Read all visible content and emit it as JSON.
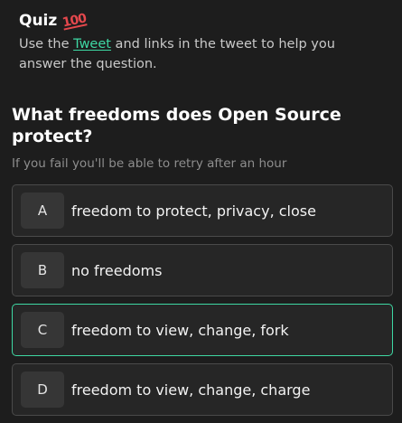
{
  "quiz": {
    "title": "Quiz",
    "emoji": "100",
    "intro_before": "Use the ",
    "intro_link": "Tweet",
    "intro_after": " and links in the tweet to help you answer the question."
  },
  "question": {
    "text": "What freedoms does Open Source protect?",
    "note": "If you fail you'll be able to retry after an hour"
  },
  "answers": [
    {
      "letter": "A",
      "text": "freedom to protect, privacy, close"
    },
    {
      "letter": "B",
      "text": "no freedoms"
    },
    {
      "letter": "C",
      "text": "freedom to view, change, fork"
    },
    {
      "letter": "D",
      "text": "freedom to view, change, charge"
    }
  ],
  "selected_answer": "C",
  "colors": {
    "background": "#1d1d1d",
    "accent": "#3ed8a3",
    "emoji_red": "#e5484d"
  },
  "icons": {
    "title_emoji": "hundred-points-icon"
  }
}
